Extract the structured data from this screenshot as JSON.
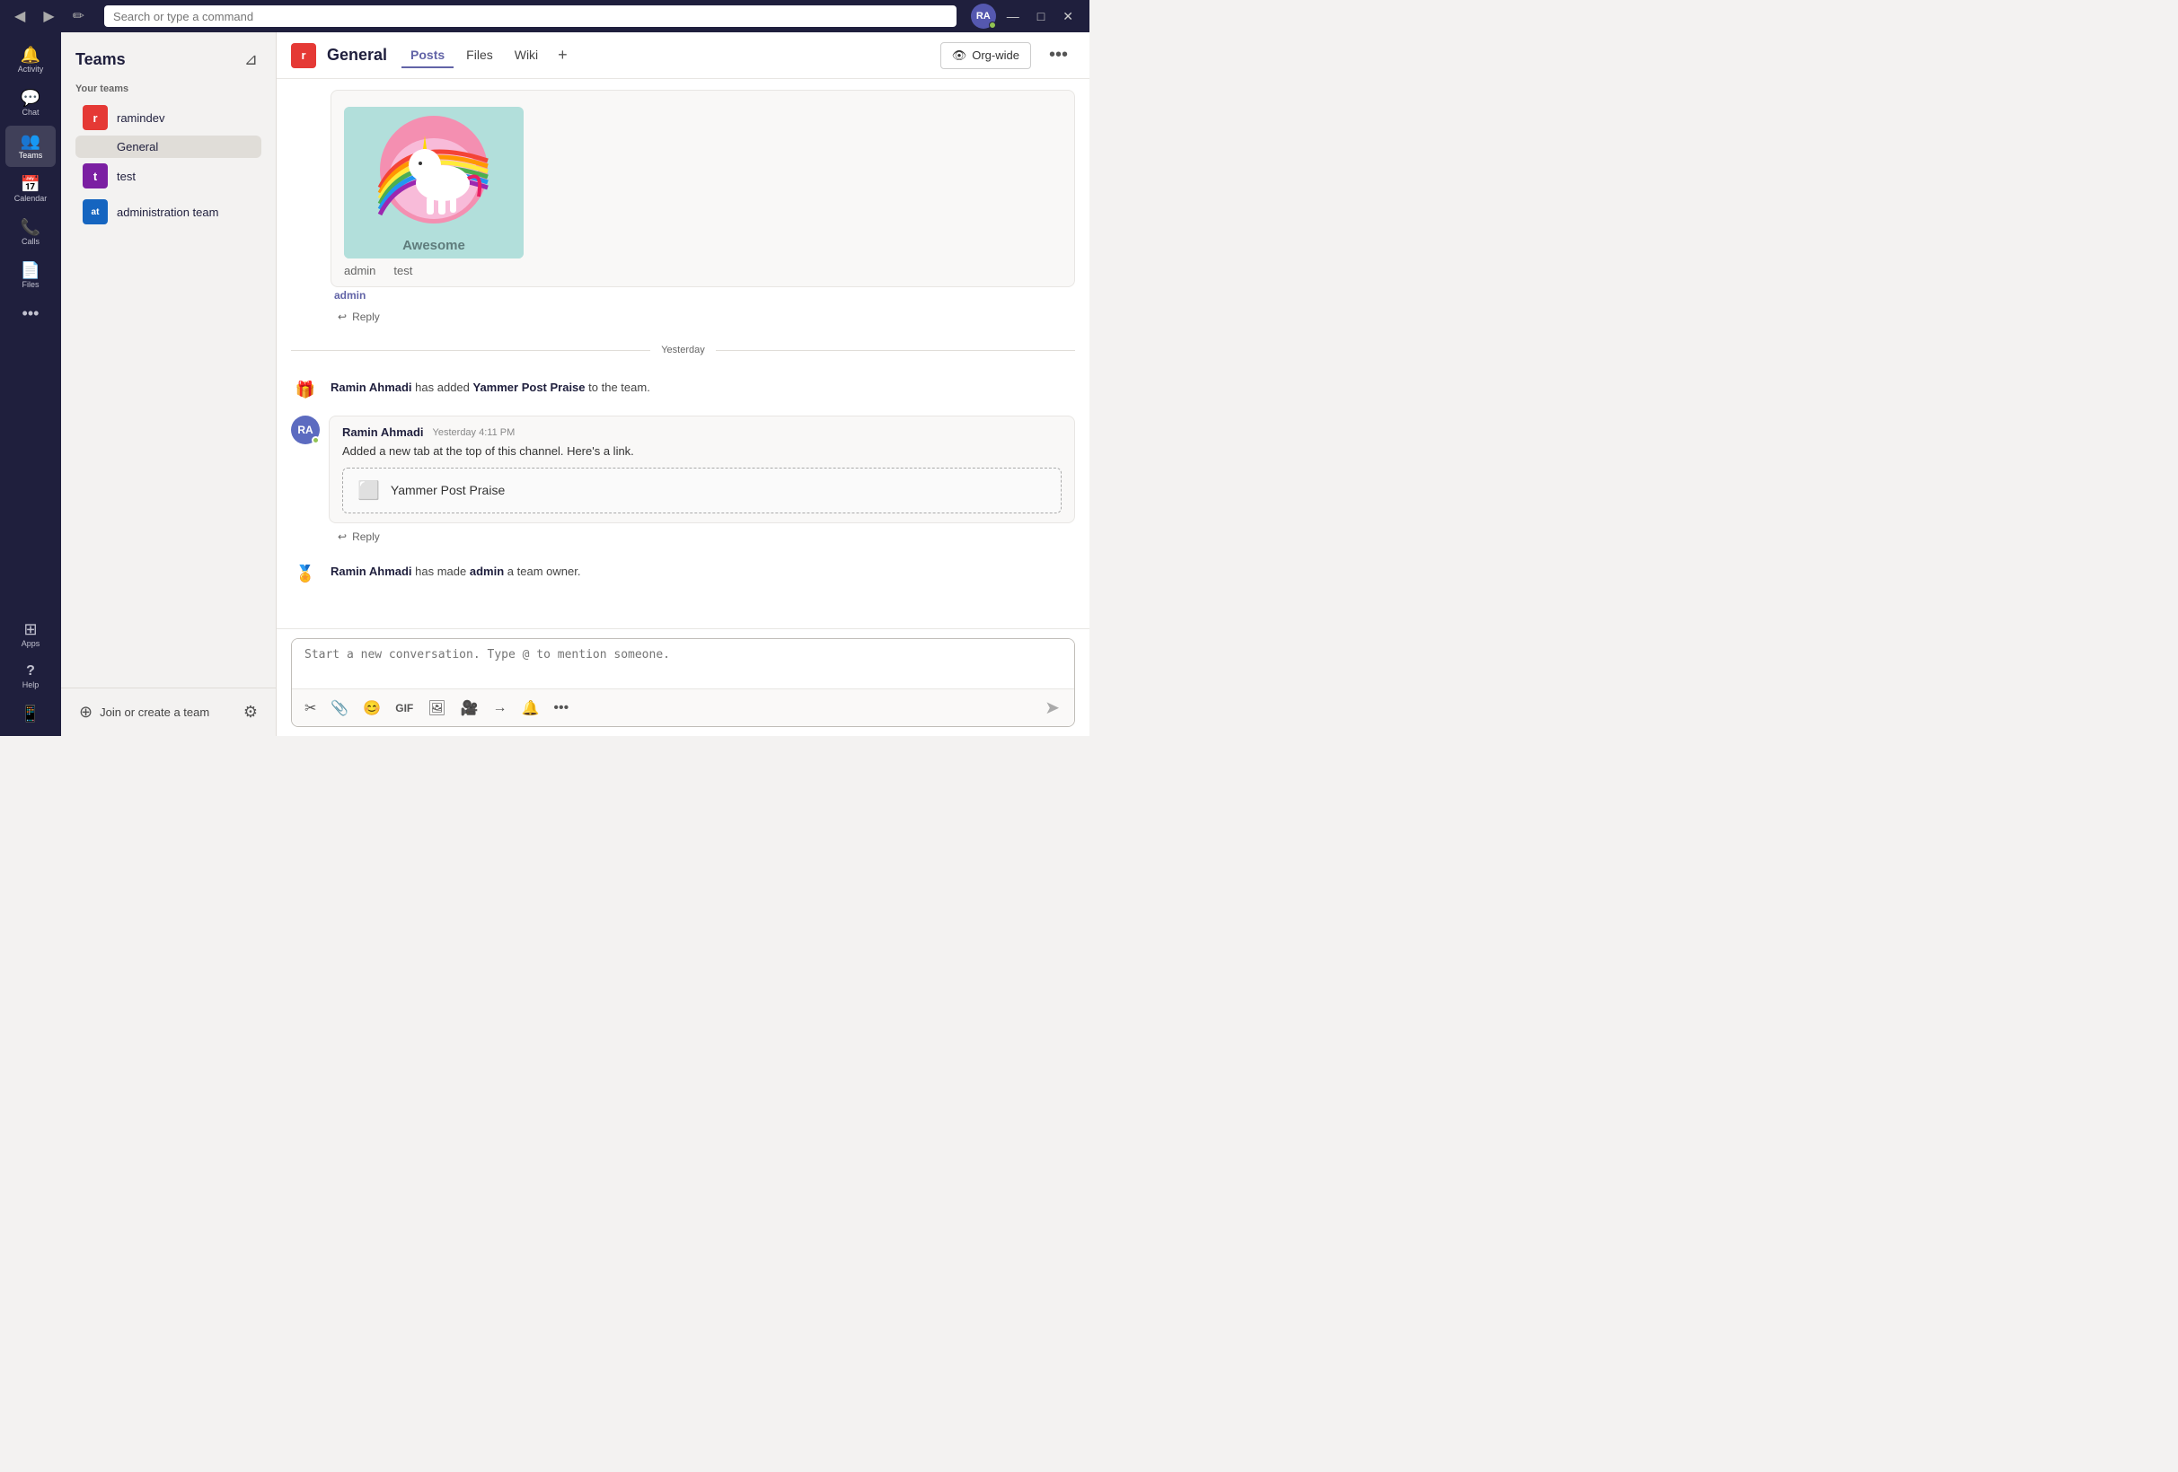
{
  "titlebar": {
    "back_label": "◀",
    "forward_label": "▶",
    "compose_label": "✏",
    "search_placeholder": "Search or type a command",
    "avatar_initials": "RA",
    "minimize_label": "—",
    "maximize_label": "□",
    "close_label": "✕"
  },
  "rail": {
    "items": [
      {
        "id": "activity",
        "icon": "🔔",
        "label": "Activity"
      },
      {
        "id": "chat",
        "icon": "💬",
        "label": "Chat"
      },
      {
        "id": "teams",
        "icon": "👥",
        "label": "Teams",
        "active": true
      },
      {
        "id": "calendar",
        "icon": "📅",
        "label": "Calendar"
      },
      {
        "id": "calls",
        "icon": "📞",
        "label": "Calls"
      },
      {
        "id": "files",
        "icon": "📄",
        "label": "Files"
      },
      {
        "id": "more",
        "icon": "•••",
        "label": ""
      }
    ],
    "bottom_items": [
      {
        "id": "apps",
        "icon": "⊞",
        "label": "Apps"
      },
      {
        "id": "help",
        "icon": "?",
        "label": "Help"
      },
      {
        "id": "device",
        "icon": "📱",
        "label": ""
      }
    ]
  },
  "sidebar": {
    "title": "Teams",
    "section_label": "Your teams",
    "filter_icon": "⊿",
    "teams": [
      {
        "id": "ramindev",
        "name": "ramindev",
        "avatar_letter": "r",
        "avatar_color": "#e53935",
        "channels": [
          {
            "id": "general",
            "name": "General",
            "active": true
          }
        ]
      },
      {
        "id": "test",
        "name": "test",
        "avatar_letter": "t",
        "avatar_color": "#7b1fa2"
      },
      {
        "id": "administration-team",
        "name": "administration team",
        "avatar_letter": "at",
        "avatar_color": "#1565c0"
      }
    ],
    "join_team_label": "Join or create a team",
    "join_icon": "⊕",
    "settings_icon": "⚙"
  },
  "channel": {
    "team_icon": "r",
    "team_icon_color": "#e53935",
    "name": "General",
    "tabs": [
      {
        "id": "posts",
        "label": "Posts",
        "active": true
      },
      {
        "id": "files",
        "label": "Files"
      },
      {
        "id": "wiki",
        "label": "Wiki"
      }
    ],
    "add_tab_icon": "+",
    "org_wide_label": "Org-wide",
    "org_wide_icon": "👁",
    "more_icon": "•••"
  },
  "messages": {
    "first_message": {
      "admin_label": "admin",
      "test_label": "test",
      "awesome_label": "Awesome",
      "name_link": "admin"
    },
    "date_divider": "Yesterday",
    "system1": {
      "text_before": "Ramin Ahmadi",
      "text_middle": " has added ",
      "highlight": "Yammer Post Praise",
      "text_after": " to the team."
    },
    "message1": {
      "author": "Ramin Ahmadi",
      "time": "Yesterday 4:11 PM",
      "text": "Added a new tab at the top of this channel. Here's a link.",
      "avatar_initials": "RA",
      "avatar_color": "#5c6bc0"
    },
    "yammer_card": {
      "name": "Yammer Post Praise"
    },
    "system2": {
      "text_before": "Ramin Ahmadi",
      "text_middle": " has made ",
      "highlight": "admin",
      "text_after": " a team owner."
    },
    "reply_label": "↩ Reply"
  },
  "compose": {
    "placeholder": "Start a new conversation. Type @ to mention someone.",
    "tools": [
      "✂",
      "📎",
      "😊",
      "GIF",
      "🖼",
      "🎥",
      "→",
      "🔔",
      "•••"
    ],
    "send_icon": "➤"
  }
}
